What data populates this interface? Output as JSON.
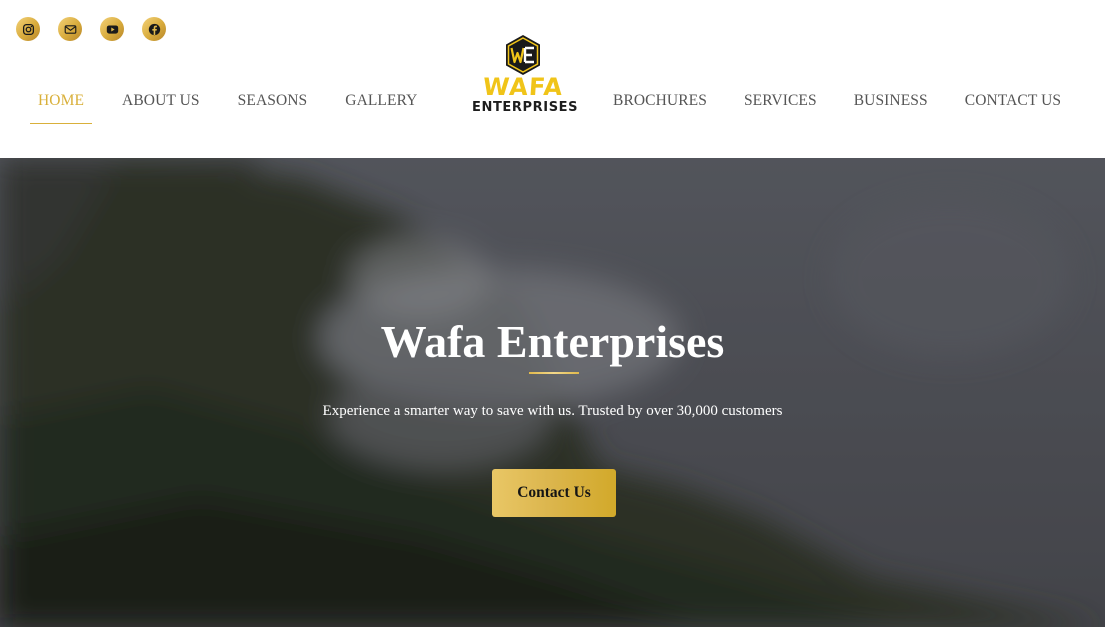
{
  "social": [
    {
      "name": "instagram-icon"
    },
    {
      "name": "mail-icon"
    },
    {
      "name": "youtube-icon"
    },
    {
      "name": "facebook-icon"
    }
  ],
  "logo": {
    "wafa": "WAFA",
    "enterprises": "ENTERPRISES"
  },
  "nav": {
    "left": [
      "HOME",
      "ABOUT US",
      "SEASONS",
      "GALLERY"
    ],
    "right": [
      "BROCHURES",
      "SERVICES",
      "BUSINESS",
      "CONTACT US"
    ],
    "active": "HOME"
  },
  "hero": {
    "title": "Wafa Enterprises",
    "subtitle": "Experience a smarter way to save with us. Trusted by over 30,000 customers",
    "button": "Contact Us"
  },
  "colors": {
    "accent_gold": "#d9b03a",
    "nav_text": "#555555",
    "hero_overlay": "#2a2b30"
  }
}
